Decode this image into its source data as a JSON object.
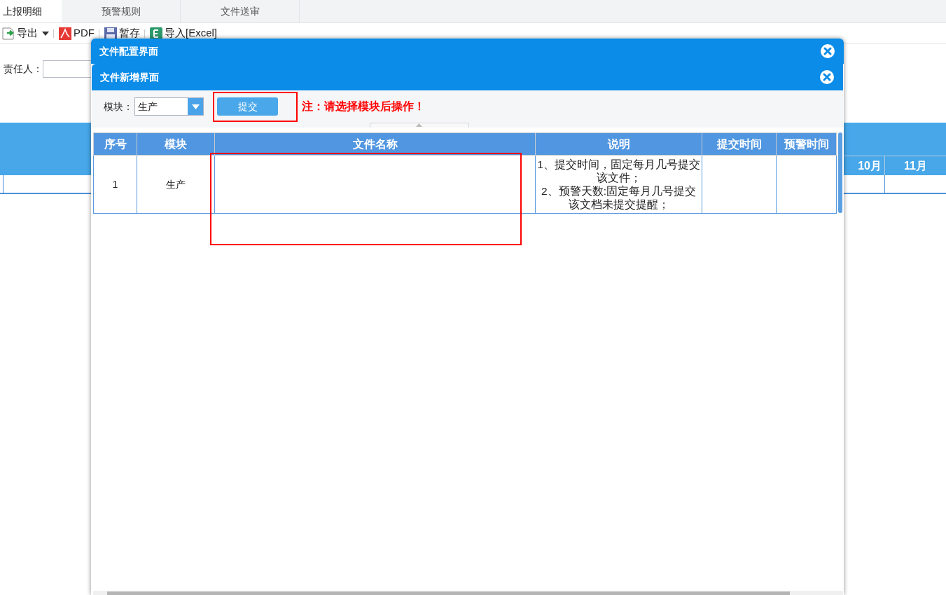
{
  "tabs": [
    {
      "label": "上报明细",
      "selected": true
    },
    {
      "label": "预警规则",
      "selected": false
    },
    {
      "label": "文件送审",
      "selected": false
    }
  ],
  "toolbar": [
    {
      "kind": "export",
      "label": "导出",
      "dropdown": true
    },
    {
      "kind": "pdf",
      "label": "PDF",
      "dropdown": false
    },
    {
      "kind": "save",
      "label": "暂存",
      "dropdown": false
    },
    {
      "kind": "excel",
      "label": "导入[Excel]",
      "dropdown": false
    }
  ],
  "filter": {
    "label": "责任人："
  },
  "background_table": {
    "columns": [
      "10月",
      "11月"
    ]
  },
  "dialogs": [
    {
      "title": "文件配置界面"
    },
    {
      "title": "文件新增界面"
    }
  ],
  "form": {
    "label": "模块：",
    "value": "生产",
    "submit": "提交",
    "note": "注：请选择模块后操作！"
  },
  "table": {
    "columns": [
      "序号",
      "模块",
      "文件名称",
      "说明",
      "提交时间",
      "预警时间"
    ],
    "rows": [
      {
        "index": "1",
        "module": "生产",
        "description": [
          "1、提交时间，固定每月几号提交该文件；",
          "2、预警天数:固定每月几号提交该文档未提交提醒；"
        ]
      }
    ]
  }
}
